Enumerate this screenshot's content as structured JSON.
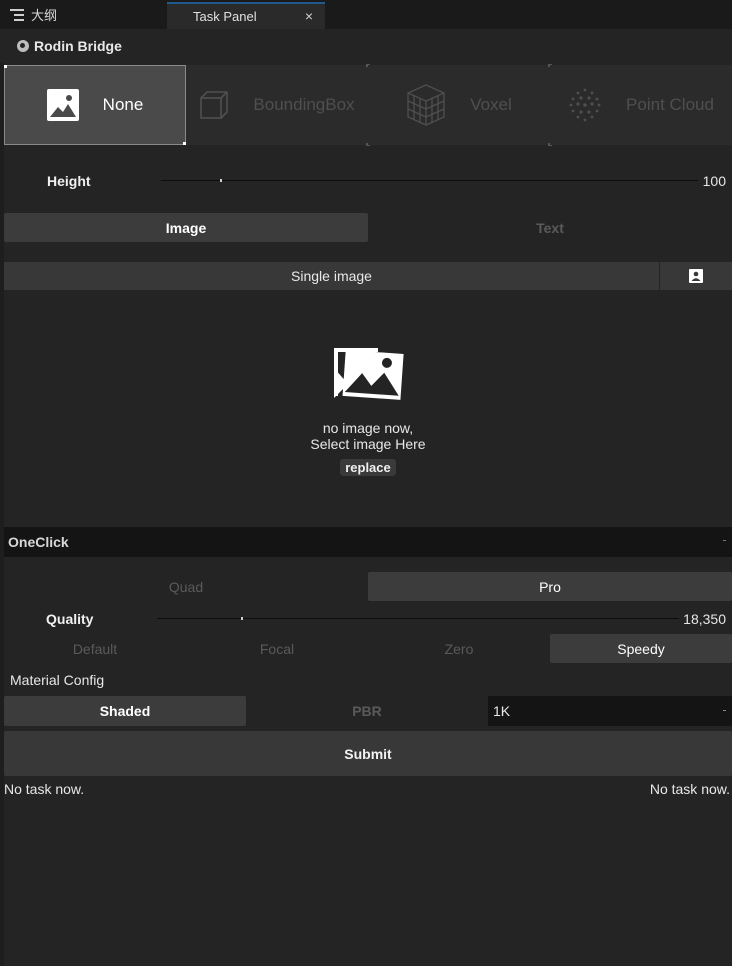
{
  "tabs": {
    "outliner": "大纲",
    "task_panel": "Task Panel",
    "close_glyph": "×"
  },
  "panel": {
    "title": "Rodin Bridge"
  },
  "modes": [
    {
      "label": "None",
      "icon": "image-icon",
      "active": true
    },
    {
      "label": "BoundingBox",
      "icon": "cube-outline-icon",
      "active": false
    },
    {
      "label": "Voxel",
      "icon": "voxel-cube-icon",
      "active": false
    },
    {
      "label": "Point Cloud",
      "icon": "point-cloud-icon",
      "active": false
    }
  ],
  "height": {
    "label": "Height",
    "value": "100",
    "fraction": 0.11
  },
  "input_mode": {
    "image": "Image",
    "text": "Text",
    "selected": "Image"
  },
  "image_input": {
    "mode_label": "Single image",
    "empty_line1": "no image now,",
    "empty_line2": "Select image Here",
    "replace": "replace"
  },
  "oneclick": {
    "title": "OneClick",
    "quad": "Quad",
    "pro": "Pro",
    "selected": "Pro"
  },
  "quality": {
    "label": "Quality",
    "value": "18,350",
    "fraction": 0.16
  },
  "presets": {
    "items": [
      "Default",
      "Focal",
      "Zero",
      "Speedy"
    ],
    "selected": "Speedy"
  },
  "material": {
    "label": "Material Config",
    "shaded": "Shaded",
    "pbr": "PBR",
    "selected": "Shaded",
    "resolution": "1K"
  },
  "submit": "Submit",
  "status": {
    "left": "No task now.",
    "right": "No task now."
  },
  "colors": {
    "background": "#242424",
    "active": "#4a4a4a",
    "button": "#383838",
    "dim_text": "#5a5a5a"
  }
}
